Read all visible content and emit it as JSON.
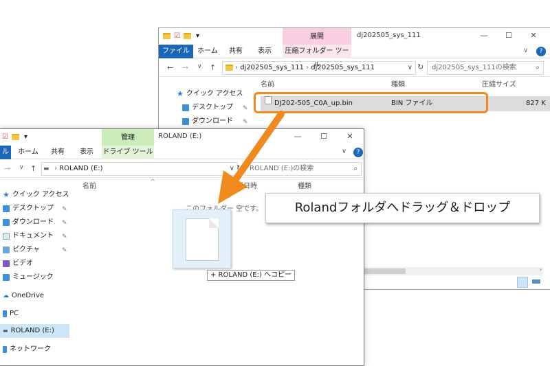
{
  "back_window": {
    "context_tab_header": "展開",
    "title": "dj202505_sys_111",
    "tabs": [
      "ファイル",
      "ホーム",
      "共有",
      "表示",
      "圧縮フォルダー ツール"
    ],
    "breadcrumb": [
      "dj202505_sys_111",
      "dj202505_sys_111"
    ],
    "search_placeholder": "dj202505_sys_111の検索",
    "columns": [
      "名前",
      "種類",
      "圧縮サイズ"
    ],
    "sidebar": [
      {
        "label": "クイック アクセス"
      },
      {
        "label": "デスクトップ"
      },
      {
        "label": "ダウンロード"
      }
    ],
    "file": {
      "name": "DJ202-505_C0A_up.bin",
      "type": "BIN ファイル",
      "size": "827 K"
    }
  },
  "front_window": {
    "context_tab_header": "管理",
    "title": "ROLAND (E:)",
    "tabs": [
      "ル",
      "ホーム",
      "共有",
      "表示",
      "ドライブ ツール"
    ],
    "address": "ROLAND (E:)",
    "search_placeholder": "ROLAND (E:)の検索",
    "columns": [
      "名前",
      "新日時",
      "種類"
    ],
    "sidebar": [
      {
        "label": "クイック アクセス"
      },
      {
        "label": "デスクトップ"
      },
      {
        "label": "ダウンロード"
      },
      {
        "label": "ドキュメント"
      },
      {
        "label": "ピクチャ"
      },
      {
        "label": "ビデオ"
      },
      {
        "label": "ミュージック"
      },
      {
        "label": "OneDrive"
      },
      {
        "label": "PC"
      },
      {
        "label": "ROLAND (E:)"
      },
      {
        "label": "ネットワーク"
      }
    ],
    "empty_message": "このフォルダー   空です。"
  },
  "drag": {
    "copy_tooltip": "+ ROLAND (E:) へコピー"
  },
  "callout": {
    "text": "Rolandフォルダへドラッグ＆ドロップ"
  },
  "colors": {
    "accent": "#1a66b8",
    "highlight": "#f08a1e",
    "selection": "#cde6f7"
  }
}
